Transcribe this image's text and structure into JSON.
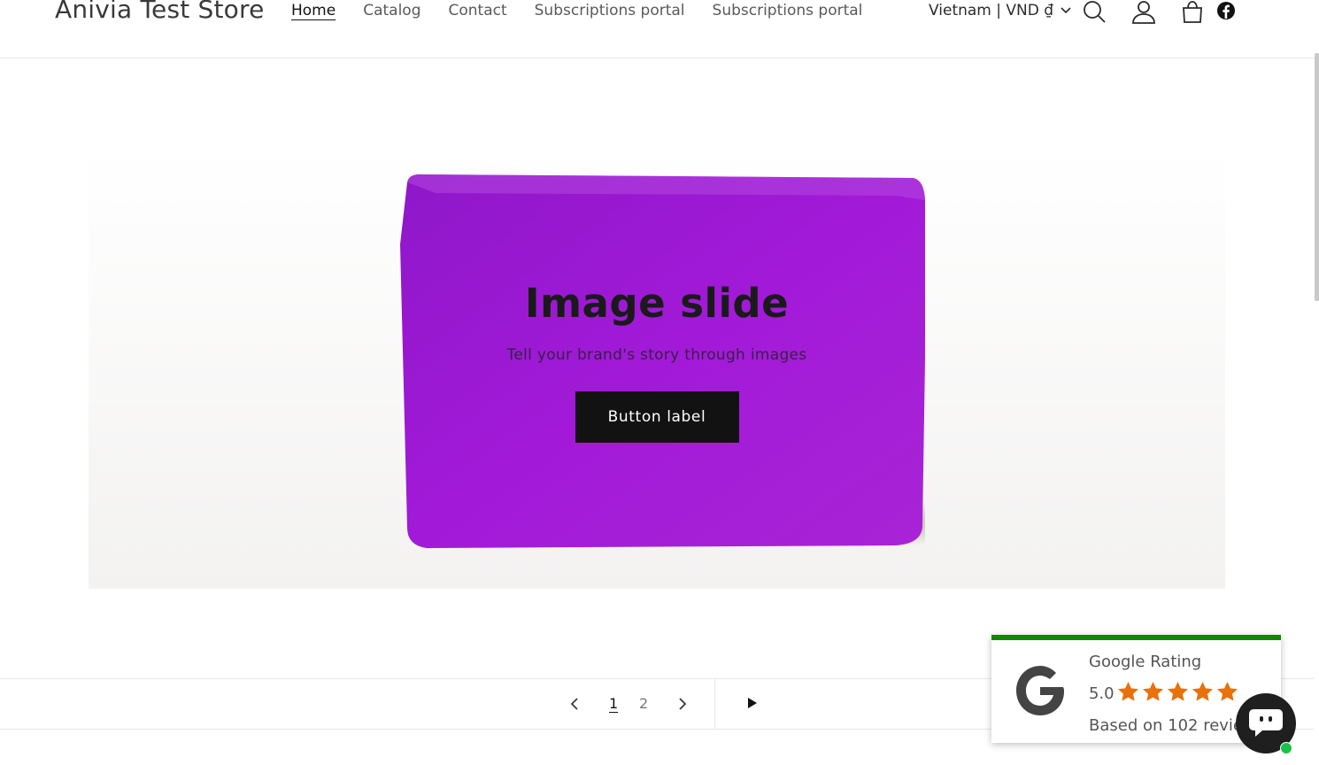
{
  "header": {
    "store_name": "Anivia Test Store",
    "nav": [
      {
        "label": "Home",
        "active": true
      },
      {
        "label": "Catalog",
        "active": false
      },
      {
        "label": "Contact",
        "active": false
      },
      {
        "label": "Subscriptions portal",
        "active": false
      },
      {
        "label": "Subscriptions portal",
        "active": false
      }
    ],
    "locale": "Vietnam | VND ₫",
    "icons": [
      "search-icon",
      "account-icon",
      "cart-icon",
      "facebook-icon"
    ]
  },
  "slide": {
    "title": "Image slide",
    "subtitle": "Tell your brand's story through images",
    "button_label": "Button label",
    "product_color": "#a21ad8"
  },
  "slider_controls": {
    "pages": [
      "1",
      "2"
    ],
    "current_page": "1"
  },
  "google_rating": {
    "title": "Google Rating",
    "score": "5.0",
    "stars": 5,
    "based_on": "Based on 102 reviews",
    "accent_color": "#0b8a00",
    "star_color": "#e8710a"
  }
}
